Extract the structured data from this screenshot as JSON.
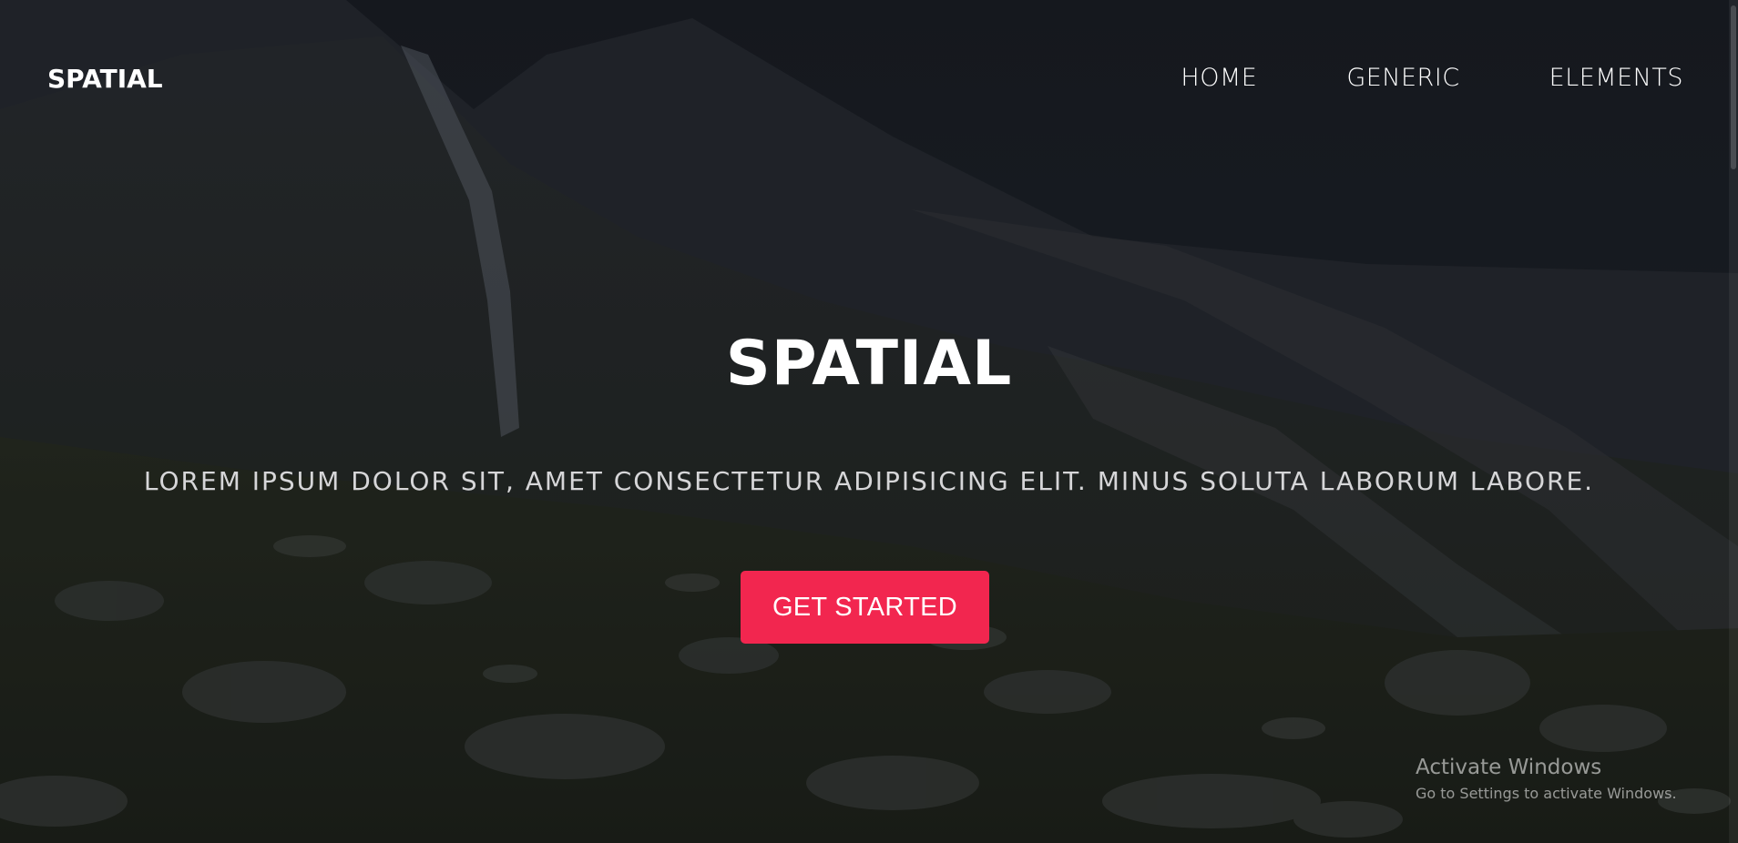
{
  "header": {
    "logo": "SPATIAL",
    "nav": [
      {
        "label": "HOME"
      },
      {
        "label": "GENERIC"
      },
      {
        "label": "ELEMENTS"
      }
    ]
  },
  "hero": {
    "title": "SPATIAL",
    "subtitle": "LOREM IPSUM DOLOR SIT, AMET CONSECTETUR ADIPISICING ELIT. MINUS SOLUTA LABORUM LABORE.",
    "cta_label": "GET STARTED"
  },
  "watermark": {
    "title": "Activate Windows",
    "subtitle": "Go to Settings to activate Windows."
  },
  "colors": {
    "accent": "#f2264f",
    "text": "#ffffff",
    "background": "#1e2126"
  }
}
